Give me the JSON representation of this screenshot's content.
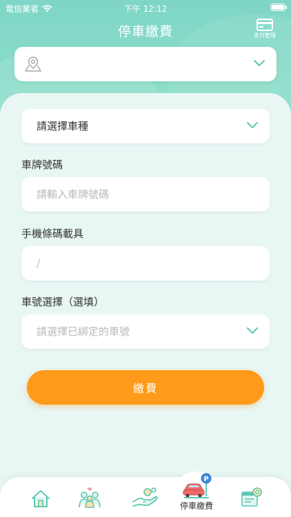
{
  "status_bar": {
    "carrier": "電信業者",
    "time": "下午 12:12"
  },
  "header": {
    "title": "停車繳費",
    "pay_management_label": "支付管理",
    "pay_management_icon": "credit-card-icon"
  },
  "location": {
    "icon": "map-pin-icon",
    "value": ""
  },
  "vehicle_type": {
    "placeholder": "請選擇車種"
  },
  "plate": {
    "label": "車牌號碼",
    "placeholder": "請輸入車牌號碼"
  },
  "carrier": {
    "label": "手機條碼載具",
    "value": "/"
  },
  "car_number": {
    "label": "車號選擇（選填）",
    "placeholder": "請選擇已綁定的車號"
  },
  "pay_button": {
    "label": "繳費"
  },
  "tabs": [
    {
      "icon": "home-icon",
      "label": ""
    },
    {
      "icon": "family-icon",
      "label": ""
    },
    {
      "icon": "hand-coins-icon",
      "label": ""
    },
    {
      "icon": "parking-car-icon",
      "label": "停車繳費",
      "active": true
    },
    {
      "icon": "settings-bill-icon",
      "label": ""
    }
  ],
  "colors": {
    "header_teal": "#8adcc9",
    "panel_bg": "#e8f6f4",
    "accent": "#5cc7b4",
    "button_orange": "#ff9a1a"
  }
}
